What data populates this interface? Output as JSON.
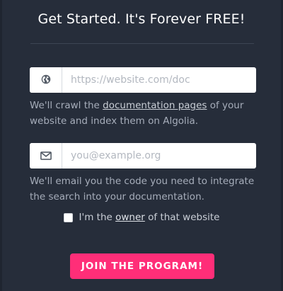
{
  "form": {
    "title": "Get Started. It's Forever FREE!",
    "url_field": {
      "placeholder": "https://website.com/doc",
      "value": "",
      "icon": "globe-icon"
    },
    "url_help": {
      "prefix": "We'll crawl the ",
      "link": "documentation pages",
      "suffix": " of your website and index them on Algolia."
    },
    "email_field": {
      "placeholder": "you@example.org",
      "value": "",
      "icon": "envelope-icon"
    },
    "email_help": "We'll email you the code you need to integrate the search into your documentation.",
    "owner_checkbox": {
      "checked": false,
      "prefix": "I'm the ",
      "link": "owner",
      "suffix": " of that website"
    },
    "submit_label": "JOIN THE PROGRAM!"
  },
  "colors": {
    "background": "#262d3a",
    "button": "#ff2e78",
    "help_text": "#a6adba"
  }
}
